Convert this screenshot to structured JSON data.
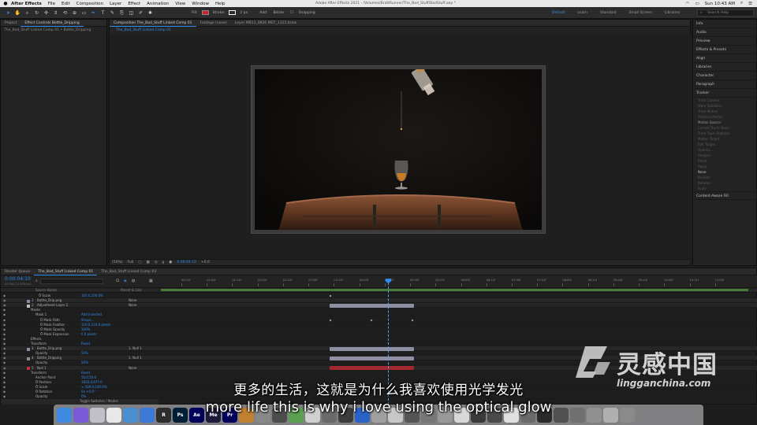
{
  "menubar": {
    "app": "After Effects",
    "items": [
      "File",
      "Edit",
      "Composition",
      "Layer",
      "Effect",
      "Animation",
      "View",
      "Window",
      "Help"
    ],
    "document_title": "Adobe After Effects 2021 - /Volumes/BrattRunner/The_Bad_Stuff/BadStuff.aep *",
    "clock": "Sun 10:43 AM"
  },
  "toolbar": {
    "fill_label": "Fill:",
    "stroke_label": "Stroke:",
    "stroke_px": "2 px",
    "add_label": "Add:",
    "bezier_label": "Bézier",
    "snapping_label": "Snapping",
    "fill_color": "#d4202a",
    "stroke_color": "#ffffff"
  },
  "workspaces": [
    "Default",
    "Learn",
    "Standard",
    "Small Screen",
    "Libraries"
  ],
  "active_workspace": "Default",
  "search_help": "Search Help",
  "project_panel": {
    "tab_project": "Project",
    "tab_effect_controls": "Effect Controls Bottle_Dripping",
    "item": "The_Bad_Stuff Linked Comp 01 • Bottle_Dripping"
  },
  "viewer": {
    "tab_composition": "Composition The_Bad_Stuff Linked Comp 01",
    "tab_footage": "Footage (none)",
    "tab_layer": "Layer MB11_0826 MDT_1322.braw",
    "breadcrumb": "The_Bad_Stuff Linked Comp 01",
    "zoom": "(50%)",
    "resolution": "Full",
    "timecode": "0:00:04:10",
    "plus_value": "+0.0"
  },
  "right_panel": {
    "items": [
      "Info",
      "Audio",
      "Preview",
      "Effects & Presets",
      "Align",
      "Libraries",
      "Character",
      "Paragraph",
      "Tracker"
    ],
    "tracker_buttons": [
      "Track Camera",
      "Warp Stabilizer",
      "Track Motion",
      "Stabilize Motion"
    ],
    "motion_source_label": "Motion Source:",
    "motion_source_value": "None",
    "current_track": "Current Track: None",
    "track_type": "Track Type: Stabilize",
    "checks": [
      "Position",
      "Rotation",
      "Scale"
    ],
    "motion_target": "Motion Target:",
    "edit_target": "Edit Target...",
    "options": "Options...",
    "analyze": "Analyze:",
    "reset": "Reset",
    "apply": "Apply",
    "content_aware_fill": "Content-Aware Fill"
  },
  "timeline": {
    "tab_render_queue": "Render Queue",
    "tab_comp": "The_Bad_Stuff Linked Comp 01",
    "tab_comp2": "The_Bad_Stuff Linked Comp 03",
    "current_time": "0:00:04:10",
    "frame_info": "00106 (23.976 fps)",
    "search_placeholder": "",
    "header_source": "Source Name",
    "header_parent": "Parent & Link",
    "ruler_labels": [
      "00:12f",
      "01:00f",
      "01:12f",
      "02:00f",
      "02:12f",
      "03:00f",
      "03:12f",
      "04:00f",
      "04:12f",
      "05:00f",
      "05:12f",
      "06:00f",
      "06:12f",
      "07:00f",
      "07:12f",
      "08:00f",
      "08:12f",
      "09:00f",
      "09:12f",
      "10:00f",
      "10:12f",
      "11:00f"
    ],
    "rows": [
      {
        "kind": "prop",
        "indent": 48,
        "name": "Ö  Scale",
        "value": "100.0,100.0%"
      },
      {
        "kind": "layer",
        "num": "1",
        "name": "Bottle_Drip.png",
        "label": "#8a8aa0",
        "parent": "None"
      },
      {
        "kind": "layer",
        "num": "2",
        "name": "Adjustment Layer 2",
        "label": "#bdbdbd",
        "parent": "None"
      },
      {
        "kind": "prop",
        "indent": 38,
        "name": "Masks",
        "value": ""
      },
      {
        "kind": "prop",
        "indent": 44,
        "name": "Mask 1",
        "value": "Add    Inverted"
      },
      {
        "kind": "prop",
        "indent": 50,
        "name": "Ö  Mask Path",
        "value": "Shape..."
      },
      {
        "kind": "prop",
        "indent": 50,
        "name": "Ö  Mask Feather",
        "value": "110.0,110.0 pixels"
      },
      {
        "kind": "prop",
        "indent": 50,
        "name": "Ö  Mask Opacity",
        "value": "100%"
      },
      {
        "kind": "prop",
        "indent": 50,
        "name": "Ö  Mask Expansion",
        "value": "0.0 pixels"
      },
      {
        "kind": "prop",
        "indent": 38,
        "name": "Effects",
        "value": ""
      },
      {
        "kind": "prop",
        "indent": 38,
        "name": "Transform",
        "value": "Reset"
      },
      {
        "kind": "layer",
        "num": "3",
        "name": "Bottle_Drip.png",
        "label": "#8a8aa0",
        "parent": "1. Null 1"
      },
      {
        "kind": "prop",
        "indent": 44,
        "name": "Opacity",
        "value": "50%"
      },
      {
        "kind": "layer",
        "num": "4",
        "name": "Bottle_Dripping",
        "label": "#8a8aa0",
        "parent": "1. Null 1"
      },
      {
        "kind": "prop",
        "indent": 44,
        "name": "Opacity",
        "value": "50%"
      },
      {
        "kind": "layer",
        "num": "5",
        "name": "Null 1",
        "label": "#c2303a",
        "parent": "None"
      },
      {
        "kind": "prop",
        "indent": 38,
        "name": "Transform",
        "value": "Reset"
      },
      {
        "kind": "prop",
        "indent": 44,
        "name": "Anchor Point",
        "value": "50.0,50.0"
      },
      {
        "kind": "prop",
        "indent": 44,
        "name": "Ö  Position",
        "value": "1820.0,877.0"
      },
      {
        "kind": "prop",
        "indent": 44,
        "name": "Ö  Scale",
        "value": "∞ 100.0,100.0%"
      },
      {
        "kind": "prop",
        "indent": 44,
        "name": "Ö  Rotation",
        "value": "0x +0.0°"
      },
      {
        "kind": "prop",
        "indent": 44,
        "name": "Opacity",
        "value": "0%"
      }
    ],
    "footer": "Toggle Switches / Modes"
  },
  "subtitles": {
    "chinese": "更多的生活，这就是为什么我喜欢使用光学发光",
    "english": "more life this is why i love using the optical glow"
  },
  "watermark": {
    "chinese": "灵感中国",
    "domain": "lingganchina.com"
  },
  "dock_icons": [
    "finder-icon",
    "siri-icon",
    "launchpad-icon",
    "chrome-icon",
    "preview-icon",
    "mail-icon",
    "resolve-icon",
    "photoshop-icon",
    "after-effects-icon",
    "media-encoder-icon",
    "premiere-icon",
    "app-icon-1",
    "app-icon-2",
    "app-icon-3",
    "app-icon-4",
    "app-icon-5",
    "app-icon-6",
    "app-icon-7",
    "app-icon-8",
    "app-icon-9",
    "app-icon-10",
    "app-icon-11",
    "app-icon-12",
    "app-icon-13",
    "app-icon-14",
    "app-icon-15",
    "app-icon-16",
    "app-icon-17",
    "app-icon-18",
    "app-icon-19",
    "app-icon-20",
    "app-icon-21",
    "app-icon-22",
    "app-icon-23",
    "trash-icon"
  ]
}
